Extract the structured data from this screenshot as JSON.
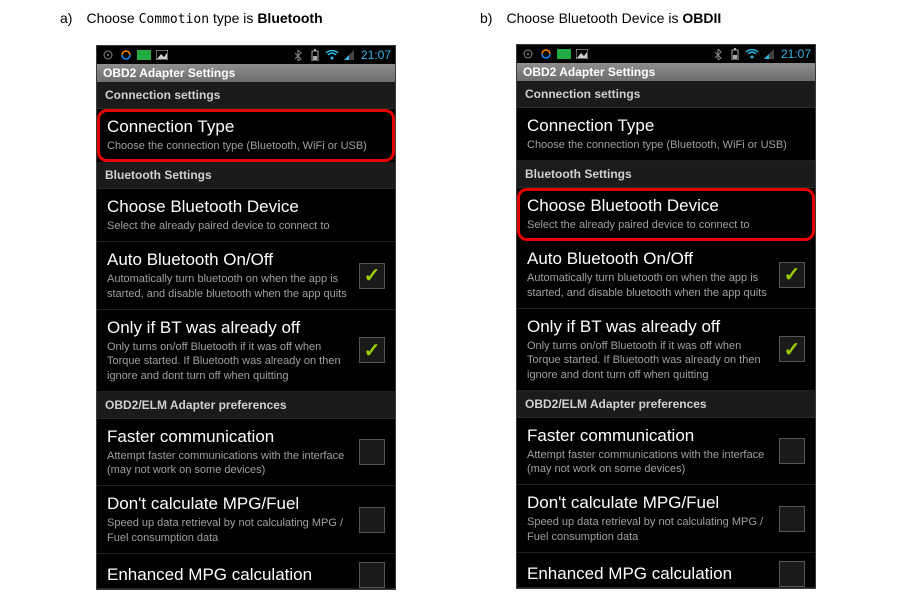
{
  "captions": {
    "a": {
      "letter": "a)",
      "pre": "Choose ",
      "mono": "Commotion",
      "post": " type is ",
      "bold": "Bluetooth"
    },
    "b": {
      "letter": "b)",
      "pre": "Choose Bluetooth Device is ",
      "bold": "OBDII"
    }
  },
  "statusbar": {
    "time": "21:07"
  },
  "appbar": {
    "title": "OBD2 Adapter Settings"
  },
  "sections": {
    "connection": "Connection settings",
    "bluetooth": "Bluetooth Settings",
    "obd2": "OBD2/ELM Adapter preferences"
  },
  "settings": {
    "conn_type": {
      "title": "Connection Type",
      "sub": "Choose the connection type (Bluetooth, WiFi or USB)"
    },
    "choose_bt": {
      "title": "Choose Bluetooth Device",
      "sub": "Select the already paired device to connect to"
    },
    "auto_bt": {
      "title": "Auto Bluetooth On/Off",
      "sub": "Automatically turn bluetooth on when the app is started, and disable bluetooth when the app quits"
    },
    "only_off": {
      "title": "Only if BT was already off",
      "sub": "Only turns on/off Bluetooth if it was off when Torque started. If Bluetooth was already on then ignore and dont turn off when quitting"
    },
    "faster": {
      "title": "Faster communication",
      "sub": "Attempt faster communications with the interface (may not work on some devices)"
    },
    "no_mpg": {
      "title": "Don't calculate MPG/Fuel",
      "sub": "Speed up data retrieval by not calculating MPG / Fuel consumption data"
    },
    "enh_mpg": {
      "title": "Enhanced MPG calculation"
    }
  }
}
